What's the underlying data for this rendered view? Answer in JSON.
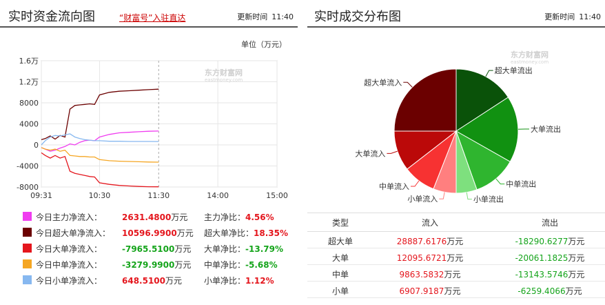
{
  "left": {
    "title": "实时资金流向图",
    "link": "“财富号”入驻直达",
    "update_label": "更新时间",
    "update_time": "11:40",
    "unit": "单位（万元）",
    "watermark_cn": "东方财富网",
    "watermark_en": "eastmoney.com"
  },
  "chart_data": {
    "type": "line",
    "title": "",
    "x_ticks": [
      "09:31",
      "10:30",
      "11:30",
      "14:00",
      "15:00"
    ],
    "y_ticks": [
      "1.6万",
      "1.2万",
      "8000",
      "4000",
      "0",
      "-4000",
      "-8000"
    ],
    "ylim": [
      -8000,
      16000
    ],
    "xlim": [
      "09:31",
      "15:00"
    ],
    "grid": true,
    "series": [
      {
        "name": "今日主力净流入",
        "color": "#f03cf0",
        "x": [
          "09:31",
          "09:35",
          "09:40",
          "09:45",
          "09:50",
          "09:55",
          "10:00",
          "10:05",
          "10:10",
          "10:15",
          "10:20",
          "10:25",
          "10:30",
          "10:40",
          "10:50",
          "11:00",
          "11:10",
          "11:20",
          "11:30"
        ],
        "values": [
          -500,
          -800,
          -1200,
          -1000,
          -600,
          -300,
          200,
          0,
          500,
          800,
          900,
          800,
          1500,
          2000,
          2300,
          2400,
          2500,
          2600,
          2631
        ]
      },
      {
        "name": "今日超大单净流入",
        "color": "#6b0000",
        "x": [
          "09:31",
          "09:35",
          "09:40",
          "09:45",
          "09:50",
          "09:55",
          "10:00",
          "10:05",
          "10:10",
          "10:15",
          "10:20",
          "10:25",
          "10:30",
          "10:40",
          "10:50",
          "11:00",
          "11:10",
          "11:20",
          "11:30"
        ],
        "values": [
          1000,
          1200,
          1700,
          1100,
          1800,
          1500,
          6800,
          7500,
          7600,
          7700,
          7800,
          7700,
          9500,
          10000,
          10200,
          10300,
          10400,
          10500,
          10597
        ]
      },
      {
        "name": "今日大单净流入",
        "color": "#e4161d",
        "x": [
          "09:31",
          "09:35",
          "09:40",
          "09:45",
          "09:50",
          "09:55",
          "10:00",
          "10:05",
          "10:10",
          "10:15",
          "10:20",
          "10:25",
          "10:30",
          "10:40",
          "10:50",
          "11:00",
          "11:10",
          "11:20",
          "11:30"
        ],
        "values": [
          -1500,
          -2000,
          -2500,
          -2000,
          -2500,
          -2200,
          -5000,
          -5400,
          -5600,
          -5800,
          -6000,
          -6100,
          -7200,
          -7500,
          -7700,
          -7800,
          -7900,
          -7950,
          -7966
        ]
      },
      {
        "name": "今日中单净流入",
        "color": "#f5a623",
        "x": [
          "09:31",
          "09:35",
          "09:40",
          "09:45",
          "09:50",
          "09:55",
          "10:00",
          "10:05",
          "10:10",
          "10:15",
          "10:20",
          "10:25",
          "10:30",
          "10:40",
          "10:50",
          "11:00",
          "11:10",
          "11:20",
          "11:30"
        ],
        "values": [
          -500,
          -800,
          -1000,
          -800,
          -1200,
          -1000,
          -2000,
          -2100,
          -2200,
          -2200,
          -2300,
          -2300,
          -2800,
          -3000,
          -3100,
          -3150,
          -3200,
          -3250,
          -3280
        ]
      },
      {
        "name": "今日小单净流入",
        "color": "#87b8f0",
        "x": [
          "09:31",
          "09:35",
          "09:40",
          "09:45",
          "09:50",
          "09:55",
          "10:00",
          "10:05",
          "10:10",
          "10:15",
          "10:20",
          "10:25",
          "10:30",
          "10:40",
          "10:50",
          "11:00",
          "11:10",
          "11:20",
          "11:30"
        ],
        "values": [
          0,
          800,
          1500,
          1800,
          1700,
          1900,
          2100,
          1500,
          1200,
          1000,
          900,
          800,
          800,
          700,
          700,
          650,
          650,
          650,
          649
        ]
      }
    ]
  },
  "legend": [
    {
      "label": "今日主力净流入：",
      "value": "2631.4800",
      "unit": "万元",
      "ratio_label": "主力净比：",
      "ratio": "4.56%",
      "color": "#f03cf0",
      "sign": "pos"
    },
    {
      "label": "今日超大单净流入：",
      "value": "10596.9900",
      "unit": "万元",
      "ratio_label": "超大单净比：",
      "ratio": "18.35%",
      "color": "#6b0000",
      "sign": "pos"
    },
    {
      "label": "今日大单净流入：",
      "value": "-7965.5100",
      "unit": "万元",
      "ratio_label": "大单净比：",
      "ratio": "-13.79%",
      "color": "#e4161d",
      "sign": "neg"
    },
    {
      "label": "今日中单净流入：",
      "value": "-3279.9900",
      "unit": "万元",
      "ratio_label": "中单净比：",
      "ratio": "-5.68%",
      "color": "#f5a623",
      "sign": "neg"
    },
    {
      "label": "今日小单净流入：",
      "value": "648.5100",
      "unit": "万元",
      "ratio_label": "小单净比：",
      "ratio": "1.12%",
      "color": "#87b8f0",
      "sign": "pos"
    }
  ],
  "right": {
    "title": "实时成交分布图",
    "update_label": "更新时间",
    "update_time": "11:40",
    "watermark_cn": "东方财富网",
    "watermark_en": "eastmoney.com"
  },
  "pie": {
    "type": "pie",
    "slices": [
      {
        "name": "超大单流出",
        "value": 18290.6277,
        "color": "#0a5209"
      },
      {
        "name": "大单流出",
        "value": 20061.1825,
        "color": "#119111"
      },
      {
        "name": "中单流出",
        "value": 13143.5746,
        "color": "#2fb52f"
      },
      {
        "name": "小单流出",
        "value": 6259.4066,
        "color": "#7ee07e"
      },
      {
        "name": "小单流入",
        "value": 6907.9187,
        "color": "#ff7f7f"
      },
      {
        "name": "中单流入",
        "value": 9863.5832,
        "color": "#f73232"
      },
      {
        "name": "大单流入",
        "value": 12095.6721,
        "color": "#bb0909"
      },
      {
        "name": "超大单流入",
        "value": 28887.6176,
        "color": "#6b0000"
      }
    ]
  },
  "table": {
    "headers": [
      "类型",
      "流入",
      "流出"
    ],
    "unit": "万元",
    "rows": [
      {
        "type": "超大单",
        "in": "28887.6176",
        "out": "-18290.6277"
      },
      {
        "type": "大单",
        "in": "12095.6721",
        "out": "-20061.1825"
      },
      {
        "type": "中单",
        "in": "9863.5832",
        "out": "-13143.5746"
      },
      {
        "type": "小单",
        "in": "6907.9187",
        "out": "-6259.4066"
      }
    ]
  }
}
